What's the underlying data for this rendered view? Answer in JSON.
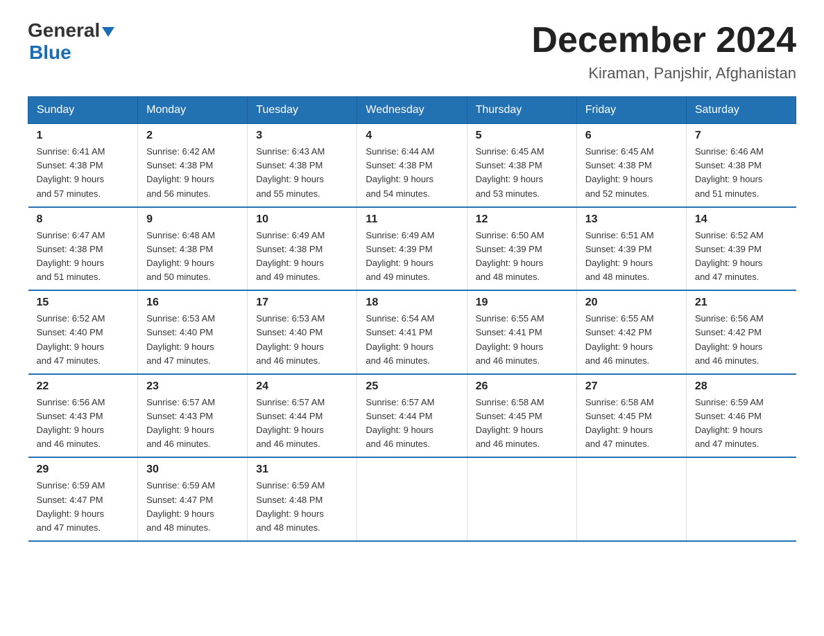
{
  "logo": {
    "general": "General",
    "blue": "Blue",
    "arrow_symbol": "▲"
  },
  "title": {
    "month_year": "December 2024",
    "location": "Kiraman, Panjshir, Afghanistan"
  },
  "days_of_week": [
    "Sunday",
    "Monday",
    "Tuesday",
    "Wednesday",
    "Thursday",
    "Friday",
    "Saturday"
  ],
  "weeks": [
    [
      {
        "day": "1",
        "sunrise": "6:41 AM",
        "sunset": "4:38 PM",
        "daylight": "9 hours and 57 minutes."
      },
      {
        "day": "2",
        "sunrise": "6:42 AM",
        "sunset": "4:38 PM",
        "daylight": "9 hours and 56 minutes."
      },
      {
        "day": "3",
        "sunrise": "6:43 AM",
        "sunset": "4:38 PM",
        "daylight": "9 hours and 55 minutes."
      },
      {
        "day": "4",
        "sunrise": "6:44 AM",
        "sunset": "4:38 PM",
        "daylight": "9 hours and 54 minutes."
      },
      {
        "day": "5",
        "sunrise": "6:45 AM",
        "sunset": "4:38 PM",
        "daylight": "9 hours and 53 minutes."
      },
      {
        "day": "6",
        "sunrise": "6:45 AM",
        "sunset": "4:38 PM",
        "daylight": "9 hours and 52 minutes."
      },
      {
        "day": "7",
        "sunrise": "6:46 AM",
        "sunset": "4:38 PM",
        "daylight": "9 hours and 51 minutes."
      }
    ],
    [
      {
        "day": "8",
        "sunrise": "6:47 AM",
        "sunset": "4:38 PM",
        "daylight": "9 hours and 51 minutes."
      },
      {
        "day": "9",
        "sunrise": "6:48 AM",
        "sunset": "4:38 PM",
        "daylight": "9 hours and 50 minutes."
      },
      {
        "day": "10",
        "sunrise": "6:49 AM",
        "sunset": "4:38 PM",
        "daylight": "9 hours and 49 minutes."
      },
      {
        "day": "11",
        "sunrise": "6:49 AM",
        "sunset": "4:39 PM",
        "daylight": "9 hours and 49 minutes."
      },
      {
        "day": "12",
        "sunrise": "6:50 AM",
        "sunset": "4:39 PM",
        "daylight": "9 hours and 48 minutes."
      },
      {
        "day": "13",
        "sunrise": "6:51 AM",
        "sunset": "4:39 PM",
        "daylight": "9 hours and 48 minutes."
      },
      {
        "day": "14",
        "sunrise": "6:52 AM",
        "sunset": "4:39 PM",
        "daylight": "9 hours and 47 minutes."
      }
    ],
    [
      {
        "day": "15",
        "sunrise": "6:52 AM",
        "sunset": "4:40 PM",
        "daylight": "9 hours and 47 minutes."
      },
      {
        "day": "16",
        "sunrise": "6:53 AM",
        "sunset": "4:40 PM",
        "daylight": "9 hours and 47 minutes."
      },
      {
        "day": "17",
        "sunrise": "6:53 AM",
        "sunset": "4:40 PM",
        "daylight": "9 hours and 46 minutes."
      },
      {
        "day": "18",
        "sunrise": "6:54 AM",
        "sunset": "4:41 PM",
        "daylight": "9 hours and 46 minutes."
      },
      {
        "day": "19",
        "sunrise": "6:55 AM",
        "sunset": "4:41 PM",
        "daylight": "9 hours and 46 minutes."
      },
      {
        "day": "20",
        "sunrise": "6:55 AM",
        "sunset": "4:42 PM",
        "daylight": "9 hours and 46 minutes."
      },
      {
        "day": "21",
        "sunrise": "6:56 AM",
        "sunset": "4:42 PM",
        "daylight": "9 hours and 46 minutes."
      }
    ],
    [
      {
        "day": "22",
        "sunrise": "6:56 AM",
        "sunset": "4:43 PM",
        "daylight": "9 hours and 46 minutes."
      },
      {
        "day": "23",
        "sunrise": "6:57 AM",
        "sunset": "4:43 PM",
        "daylight": "9 hours and 46 minutes."
      },
      {
        "day": "24",
        "sunrise": "6:57 AM",
        "sunset": "4:44 PM",
        "daylight": "9 hours and 46 minutes."
      },
      {
        "day": "25",
        "sunrise": "6:57 AM",
        "sunset": "4:44 PM",
        "daylight": "9 hours and 46 minutes."
      },
      {
        "day": "26",
        "sunrise": "6:58 AM",
        "sunset": "4:45 PM",
        "daylight": "9 hours and 46 minutes."
      },
      {
        "day": "27",
        "sunrise": "6:58 AM",
        "sunset": "4:45 PM",
        "daylight": "9 hours and 47 minutes."
      },
      {
        "day": "28",
        "sunrise": "6:59 AM",
        "sunset": "4:46 PM",
        "daylight": "9 hours and 47 minutes."
      }
    ],
    [
      {
        "day": "29",
        "sunrise": "6:59 AM",
        "sunset": "4:47 PM",
        "daylight": "9 hours and 47 minutes."
      },
      {
        "day": "30",
        "sunrise": "6:59 AM",
        "sunset": "4:47 PM",
        "daylight": "9 hours and 48 minutes."
      },
      {
        "day": "31",
        "sunrise": "6:59 AM",
        "sunset": "4:48 PM",
        "daylight": "9 hours and 48 minutes."
      },
      null,
      null,
      null,
      null
    ]
  ],
  "labels": {
    "sunrise_prefix": "Sunrise: ",
    "sunset_prefix": "Sunset: ",
    "daylight_prefix": "Daylight: "
  }
}
